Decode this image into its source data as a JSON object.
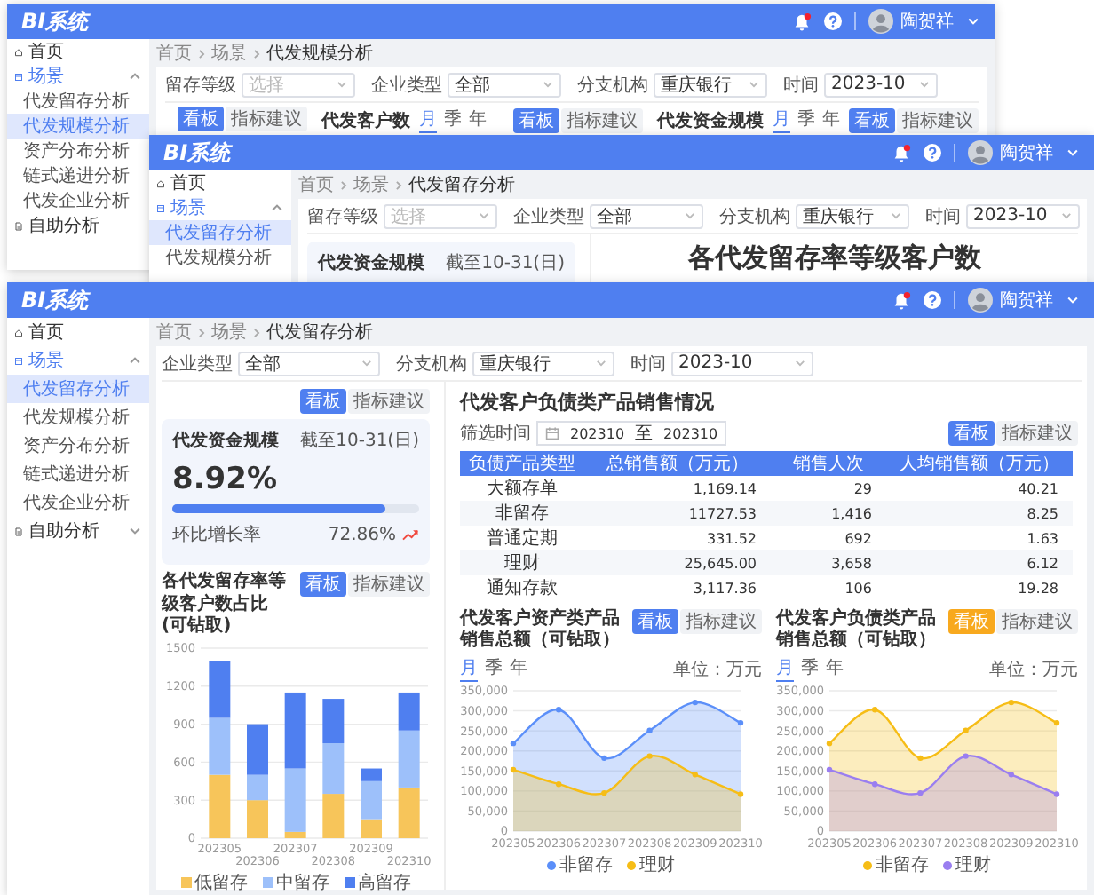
{
  "windows": [
    {
      "logo": "BI系统",
      "user": "陶贺祥",
      "sidebar": [
        {
          "label": "首页"
        },
        {
          "label": "场景",
          "expanded": true,
          "children": [
            {
              "label": "代发留存分析",
              "selected": false
            },
            {
              "label": "代发规模分析",
              "selected": true
            },
            {
              "label": "资产分布分析",
              "selected": false
            },
            {
              "label": "链式递进分析",
              "selected": false
            },
            {
              "label": "代发企业分析",
              "selected": false
            }
          ]
        },
        {
          "label": "自助分析"
        }
      ],
      "breadcrumb": [
        "首页",
        "场景",
        "代发规模分析"
      ],
      "filters": [
        {
          "label": "留存等级",
          "placeholder": "选择"
        },
        {
          "label": "企业类型",
          "value": "全部"
        },
        {
          "label": "分支机构",
          "value": "重庆银行"
        },
        {
          "label": "时间",
          "value": "2023-10"
        }
      ],
      "body": {
        "kind": "heads",
        "panels": [
          {
            "buttons": [
              {
                "label": "看板",
                "selected": true
              },
              {
                "label": "指标建议",
                "selected": false
              }
            ]
          },
          {
            "title": "代发客户数",
            "periods": [
              {
                "label": "月",
                "selected": true
              },
              {
                "label": "季",
                "selected": false
              },
              {
                "label": "年",
                "selected": false
              }
            ],
            "buttons": [
              {
                "label": "看板",
                "selected": true
              },
              {
                "label": "指标建议",
                "selected": false
              }
            ]
          },
          {
            "title": "代发资金规模",
            "periods": [
              {
                "label": "月",
                "selected": true
              },
              {
                "label": "季",
                "selected": false
              },
              {
                "label": "年",
                "selected": false
              }
            ],
            "buttons": [
              {
                "label": "看板",
                "selected": true
              },
              {
                "label": "指标建议",
                "selected": false
              }
            ]
          }
        ]
      }
    },
    {
      "logo": "BI系统",
      "user": "陶贺祥",
      "sidebar": [
        {
          "label": "首页"
        },
        {
          "label": "场景",
          "expanded": true,
          "children": [
            {
              "label": "代发留存分析",
              "selected": true
            },
            {
              "label": "代发规模分析",
              "selected": false
            }
          ]
        }
      ],
      "breadcrumb": [
        "首页",
        "场景",
        "代发留存分析"
      ],
      "filters": [
        {
          "label": "留存等级",
          "placeholder": "选择"
        },
        {
          "label": "企业类型",
          "value": "全部"
        },
        {
          "label": "分支机构",
          "value": "重庆银行"
        },
        {
          "label": "时间",
          "value": "2023-10"
        }
      ],
      "body": {
        "kind": "preview",
        "card": {
          "title": "代发资金规模",
          "date": "截至10-31(日)"
        },
        "title": "各代发留存率等级客户数"
      }
    },
    {
      "logo": "BI系统",
      "user": "陶贺祥",
      "sidebar": [
        {
          "label": "首页"
        },
        {
          "label": "场景",
          "expanded": true,
          "children": [
            {
              "label": "代发留存分析",
              "selected": true
            },
            {
              "label": "代发规模分析",
              "selected": false
            },
            {
              "label": "资产分布分析",
              "selected": false
            },
            {
              "label": "链式递进分析",
              "selected": false
            },
            {
              "label": "代发企业分析",
              "selected": false
            }
          ]
        },
        {
          "label": "自助分析",
          "expanded": false
        }
      ],
      "breadcrumb": [
        "首页",
        "场景",
        "代发留存分析"
      ],
      "filters": [
        {
          "label": "企业类型",
          "value": "全部"
        },
        {
          "label": "分支机构",
          "value": "重庆银行"
        },
        {
          "label": "时间",
          "value": "2023-10"
        }
      ],
      "body": {
        "kind": "dashboard",
        "overview": {
          "buttons": [
            {
              "label": "看板",
              "selected": true
            },
            {
              "label": "指标建议",
              "selected": false
            }
          ],
          "card": {
            "title": "代发资金规模",
            "date": "截至10-31(日)",
            "value": "8.92%",
            "level": 0.86,
            "label": "环比增长率",
            "change": "72.86%"
          },
          "chart": {
            "title": "各代发留存率等级客户数占比(可钻取)",
            "buttons": [
              {
                "label": "看板",
                "selected": true
              },
              {
                "label": "指标建议",
                "selected": false
              }
            ],
            "chart_data": {
              "type": "bar",
              "stacked": true,
              "grid": true,
              "categories": [
                "202305",
                "202306",
                "202307",
                "202308",
                "202309",
                "202310"
              ],
              "ylim": [
                0,
                1500
              ],
              "yticks": [
                0,
                300,
                600,
                900,
                1200,
                1500
              ],
              "series": [
                {
                  "name": "低留存",
                  "color": "#f7c55a",
                  "values": [
                    500,
                    300,
                    50,
                    350,
                    150,
                    400
                  ]
                },
                {
                  "name": "中留存",
                  "color": "#9dc0fa",
                  "values": [
                    450,
                    200,
                    500,
                    400,
                    300,
                    450
                  ]
                },
                {
                  "name": "高留存",
                  "color": "#4f7ff0",
                  "values": [
                    450,
                    400,
                    600,
                    350,
                    100,
                    300
                  ]
                }
              ]
            }
          }
        },
        "sales": {
          "title": "代发客户负债类产品销售情况",
          "filter": {
            "label": "筛选时间",
            "from": "202310",
            "separator": "至",
            "to": "202310"
          },
          "buttons": [
            {
              "label": "看板",
              "selected": true
            },
            {
              "label": "指标建议",
              "selected": false
            }
          ],
          "table": {
            "columns": [
              "负债产品类型",
              "总销售额（万元）",
              "销售人次",
              "人均销售额（万元）"
            ],
            "rows": [
              [
                "大额存单",
                "1,169.14",
                "29",
                "40.21"
              ],
              [
                "非留存",
                "11727.53",
                "1,416",
                "8.25"
              ],
              [
                "普通定期",
                "331.52",
                "692",
                "1.63"
              ],
              [
                "理财",
                "25,645.00",
                "3,658",
                "6.12"
              ],
              [
                "通知存款",
                "3,117.36",
                "106",
                "19.28"
              ]
            ]
          },
          "charts": [
            {
              "title": "代发客户资产类产品销售总额（可钻取）",
              "buttons": [
                {
                  "label": "看板",
                  "selected": true
                },
                {
                  "label": "指标建议",
                  "selected": false
                }
              ],
              "periods": [
                {
                  "label": "月",
                  "selected": true
                },
                {
                  "label": "季",
                  "selected": false
                },
                {
                  "label": "年",
                  "selected": false
                }
              ],
              "unit": "单位：万元",
              "chart_data": {
                "type": "area",
                "grid": true,
                "categories": [
                  "202305",
                  "202306",
                  "202307",
                  "202308",
                  "202309",
                  "202310"
                ],
                "ylim": [
                  0,
                  350000
                ],
                "yticks": [
                  {
                    "value": 0,
                    "label": "0"
                  },
                  {
                    "value": 50000,
                    "label": "50,000"
                  },
                  {
                    "value": 100000,
                    "label": "100,000"
                  },
                  {
                    "value": 150000,
                    "label": "150,000"
                  },
                  {
                    "value": 200000,
                    "label": "200,000"
                  },
                  {
                    "value": 250000,
                    "label": "250,000"
                  },
                  {
                    "value": 300000,
                    "label": "300,000"
                  },
                  {
                    "value": 350000,
                    "label": "350,000"
                  }
                ],
                "series": [
                  {
                    "name": "非留存",
                    "color": "#5b8ff9",
                    "values": [
                      219000,
                      303000,
                      182000,
                      251000,
                      321000,
                      270000
                    ]
                  },
                  {
                    "name": "理财",
                    "color": "#f6bd16",
                    "values": [
                      153000,
                      117000,
                      95000,
                      187000,
                      141000,
                      92000
                    ]
                  }
                ]
              }
            },
            {
              "title": "代发客户负债类产品销售总额（可钻取）",
              "buttons": [
                {
                  "label": "看板",
                  "selected": true,
                  "color": "#f8a91e"
                },
                {
                  "label": "指标建议",
                  "selected": false
                }
              ],
              "periods": [
                {
                  "label": "月",
                  "selected": true
                },
                {
                  "label": "季",
                  "selected": false
                },
                {
                  "label": "年",
                  "selected": false
                }
              ],
              "unit": "单位：万元",
              "chart_data": {
                "type": "area",
                "grid": true,
                "categories": [
                  "202305",
                  "202306",
                  "202307",
                  "202308",
                  "202309",
                  "202310"
                ],
                "ylim": [
                  0,
                  350000
                ],
                "yticks": [
                  {
                    "value": 0,
                    "label": "0"
                  },
                  {
                    "value": 50000,
                    "label": "50,000"
                  },
                  {
                    "value": 100000,
                    "label": "100,000"
                  },
                  {
                    "value": 150000,
                    "label": "150,000"
                  },
                  {
                    "value": 200000,
                    "label": "200,000"
                  },
                  {
                    "value": 250000,
                    "label": "250,000"
                  },
                  {
                    "value": 300000,
                    "label": "300,000"
                  },
                  {
                    "value": 350000,
                    "label": "350,000"
                  }
                ],
                "series": [
                  {
                    "name": "非留存",
                    "color": "#f6bd16",
                    "values": [
                      219000,
                      303000,
                      182000,
                      251000,
                      321000,
                      270000
                    ]
                  },
                  {
                    "name": "理财",
                    "color": "#9a7ef0",
                    "values": [
                      153000,
                      117000,
                      95000,
                      187000,
                      141000,
                      92000
                    ]
                  }
                ]
              }
            }
          ]
        }
      }
    }
  ]
}
